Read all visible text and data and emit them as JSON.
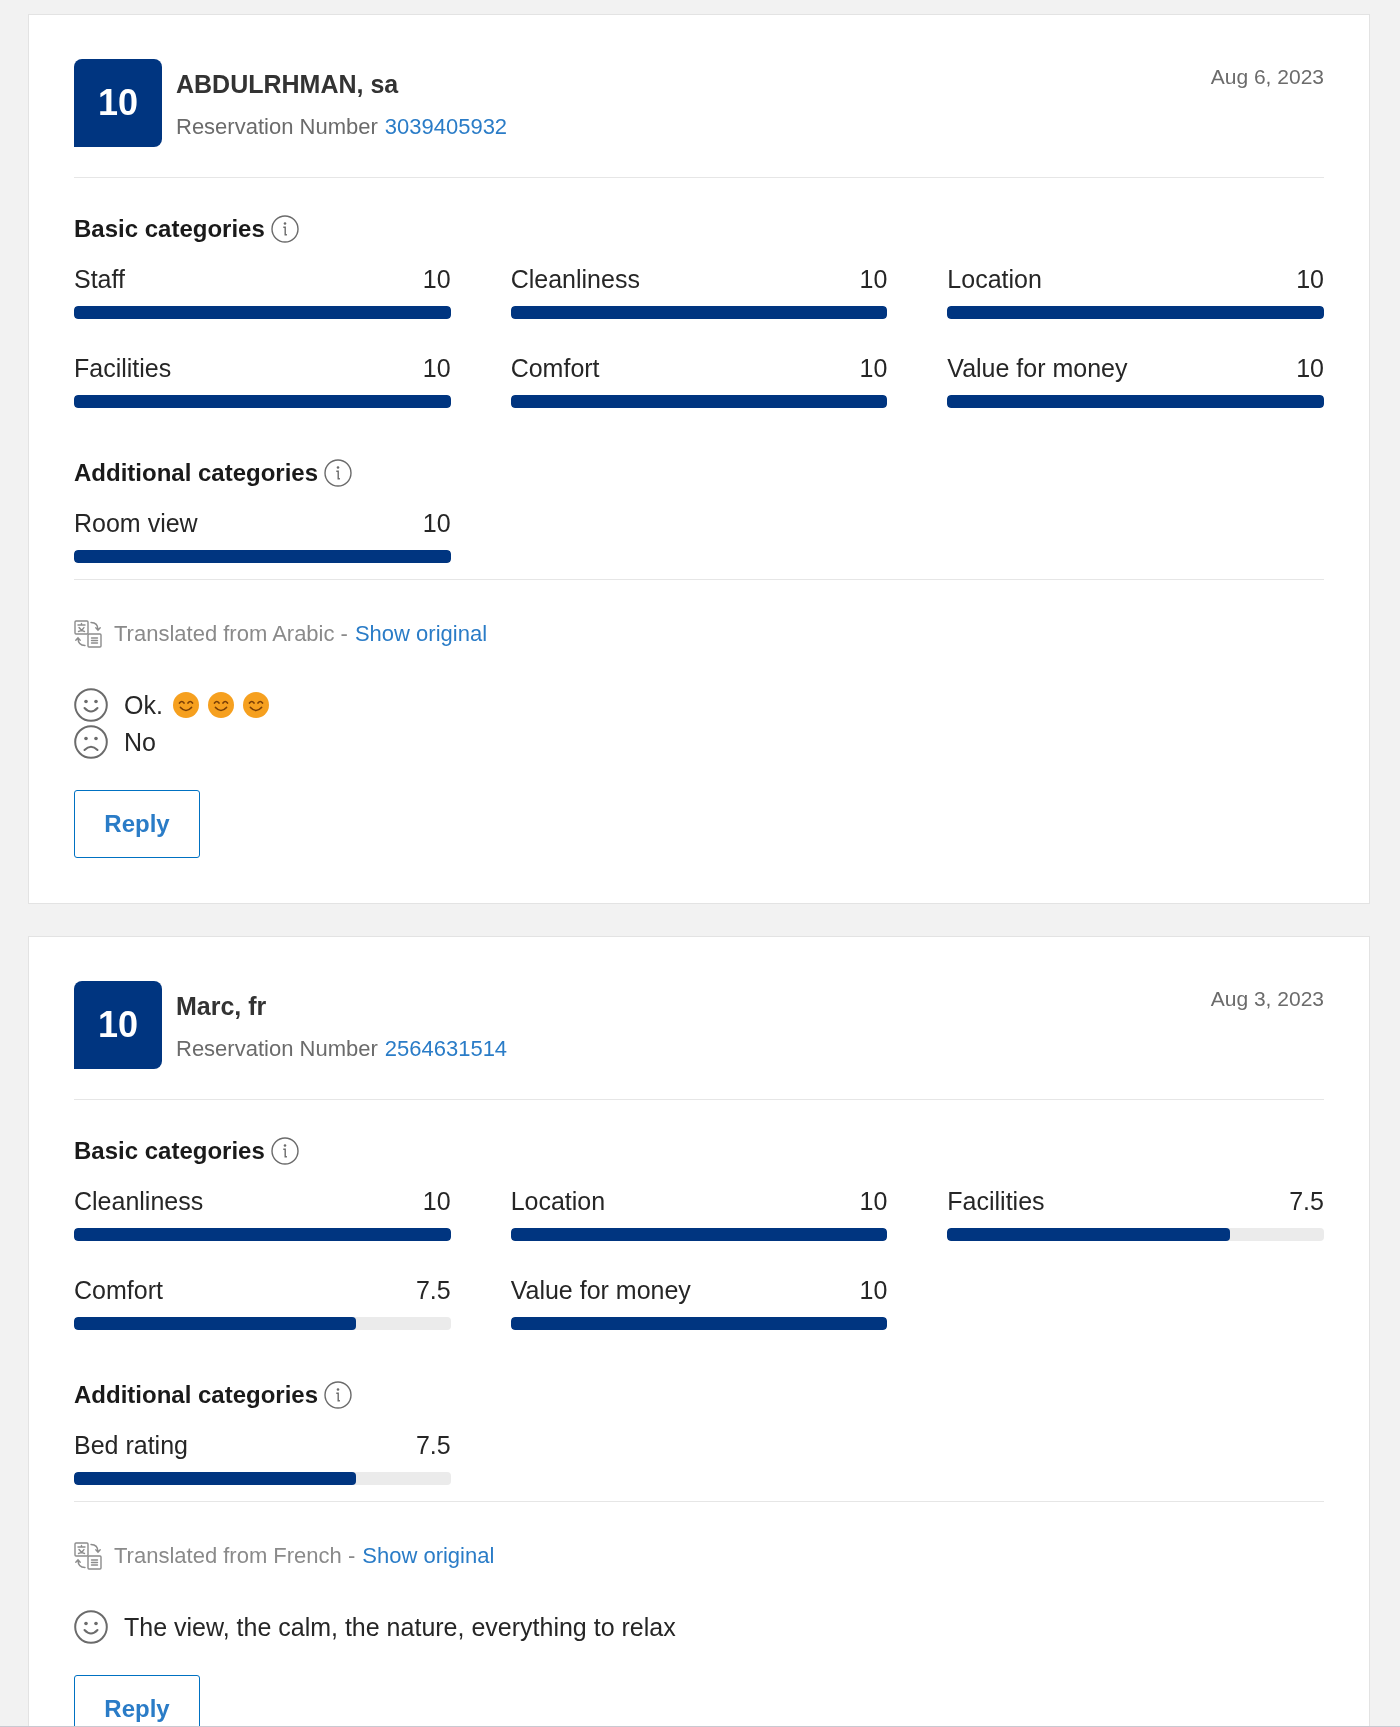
{
  "reviews": [
    {
      "score": "10",
      "name": "ABDULRHMAN, sa",
      "reservation_label": "Reservation Number",
      "reservation_number": "3039405932",
      "date": "Aug 6, 2023",
      "sections": [
        {
          "title": "Basic categories",
          "categories": [
            {
              "label": "Staff",
              "score": "10",
              "level": 1
            },
            {
              "label": "Cleanliness",
              "score": "10",
              "level": 1
            },
            {
              "label": "Location",
              "score": "10",
              "level": 1
            },
            {
              "label": "Facilities",
              "score": "10",
              "level": 1
            },
            {
              "label": "Comfort",
              "score": "10",
              "level": 1
            },
            {
              "label": "Value for money",
              "score": "10",
              "level": 1
            }
          ]
        },
        {
          "title": "Additional categories",
          "categories": [
            {
              "label": "Room view",
              "score": "10",
              "level": 1
            }
          ]
        }
      ],
      "translation": {
        "note": "Translated from Arabic -",
        "link": "Show original"
      },
      "comments": [
        {
          "kind": "liked",
          "text": "Ok.",
          "emojis": [
            {
              "kind": "smiling"
            },
            {
              "kind": "smiling"
            },
            {
              "kind": "smiling"
            }
          ]
        },
        {
          "kind": "disliked",
          "text": "No"
        }
      ],
      "reply_button": "Reply"
    },
    {
      "score": "10",
      "name": "Marc, fr",
      "reservation_label": "Reservation Number",
      "reservation_number": "2564631514",
      "date": "Aug 3, 2023",
      "sections": [
        {
          "title": "Basic categories",
          "categories": [
            {
              "label": "Cleanliness",
              "score": "10",
              "level": 1
            },
            {
              "label": "Location",
              "score": "10",
              "level": 1
            },
            {
              "label": "Facilities",
              "score": "7.5",
              "level": 0.75
            },
            {
              "label": "Comfort",
              "score": "7.5",
              "level": 0.75
            },
            {
              "label": "Value for money",
              "score": "10",
              "level": 1
            }
          ]
        },
        {
          "title": "Additional categories",
          "categories": [
            {
              "label": "Bed rating",
              "score": "7.5",
              "level": 0.75
            }
          ]
        }
      ],
      "translation": {
        "note": "Translated from French -",
        "link": "Show original"
      },
      "comments": [
        {
          "kind": "liked",
          "text": "The view, the calm, the nature, everything to relax"
        }
      ],
      "reply_button": "Reply"
    }
  ]
}
